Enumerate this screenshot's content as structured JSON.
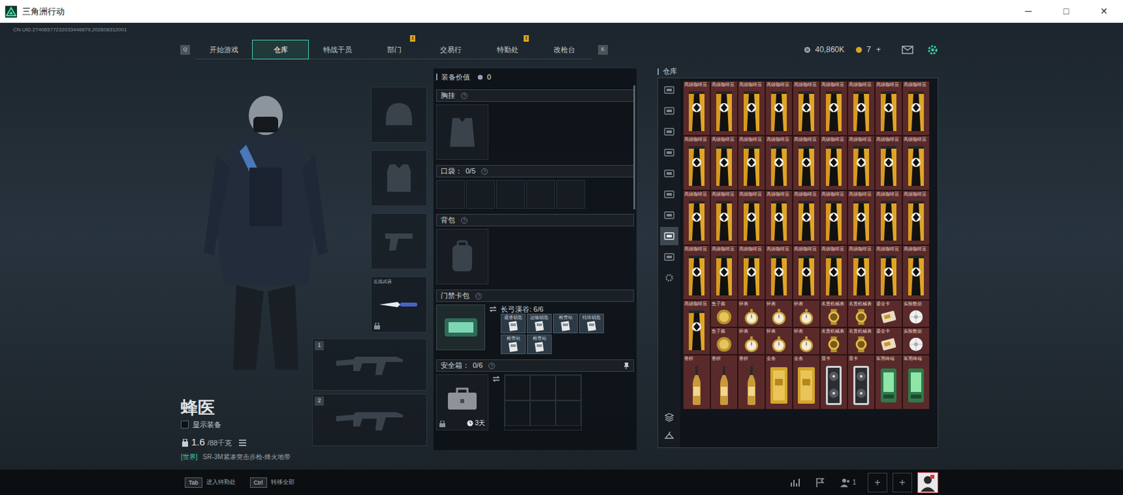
{
  "window": {
    "title": "三角洲行动",
    "controls": [
      "─",
      "□",
      "✕"
    ]
  },
  "uid": "CN.UID.27406577232033446679,202608312001",
  "nav": {
    "prev_key": "Q",
    "next_key": "E",
    "tabs": [
      {
        "label": "开始游戏",
        "selected": false
      },
      {
        "label": "仓库",
        "selected": true
      },
      {
        "label": "特战干员",
        "selected": false
      },
      {
        "label": "部门",
        "selected": false,
        "badge": "!"
      },
      {
        "label": "交易行",
        "selected": false
      },
      {
        "label": "特勤处",
        "selected": false,
        "badge": "!"
      },
      {
        "label": "改枪台",
        "selected": false
      }
    ]
  },
  "currency": {
    "coins": "40,860K",
    "tokens": "7",
    "add": "+"
  },
  "operator": {
    "name": "蜂医",
    "show_equipment": {
      "label": "显示装备",
      "checked": false
    },
    "weight": "1.6",
    "capacity": "/88千克",
    "chat_channel": "[世界]",
    "loadout": "SR-3M紧凑突击步枪-烽火地带"
  },
  "slots": {
    "melee_label": "近战武器",
    "weapon_numbers": [
      "1",
      "2"
    ]
  },
  "loadout": {
    "value_label": "装备价值",
    "value": "0",
    "chest_rig": {
      "title": "胸挂",
      "help": "?"
    },
    "pockets": {
      "title": "口袋：",
      "count": "0/5",
      "help": "?",
      "slots": [
        {
          "filled": false
        },
        {
          "filled": false
        },
        {
          "filled": false
        },
        {
          "filled": false
        },
        {
          "filled": false
        }
      ]
    },
    "backpack": {
      "title": "背包",
      "help": "?"
    },
    "keycard": {
      "title": "门禁卡包",
      "help": "?",
      "map": "长弓溪谷: 6/6",
      "cards": [
        {
          "label": "通道钥匙"
        },
        {
          "label": "运输钥匙"
        },
        {
          "label": "检查站"
        },
        {
          "label": "特殊钥匙"
        },
        {
          "label": "检查站"
        },
        {
          "label": "检查站"
        }
      ]
    },
    "safe_box": {
      "title": "安全箱：",
      "count": "0/6",
      "help": "?",
      "timer": "3天",
      "cells": [
        {
          "filled": false
        },
        {
          "filled": false
        },
        {
          "filled": false
        },
        {
          "filled": false
        },
        {
          "filled": false
        },
        {
          "filled": false
        }
      ]
    }
  },
  "warehouse": {
    "title": "仓库",
    "tabs": [
      {
        "selected": false
      },
      {
        "selected": false
      },
      {
        "selected": false
      },
      {
        "selected": false
      },
      {
        "selected": false
      },
      {
        "selected": false
      },
      {
        "selected": false
      },
      {
        "selected": true
      },
      {
        "selected": false
      },
      {
        "selected": false
      }
    ],
    "items": [
      {
        "label": "高级咖啡豆",
        "kind": "coffee"
      },
      {
        "label": "高级咖啡豆",
        "kind": "coffee"
      },
      {
        "label": "高级咖啡豆",
        "kind": "coffee"
      },
      {
        "label": "高级咖啡豆",
        "kind": "coffee"
      },
      {
        "label": "高级咖啡豆",
        "kind": "coffee"
      },
      {
        "label": "高级咖啡豆",
        "kind": "coffee"
      },
      {
        "label": "高级咖啡豆",
        "kind": "coffee"
      },
      {
        "label": "高级咖啡豆",
        "kind": "coffee"
      },
      {
        "label": "高级咖啡豆",
        "kind": "coffee"
      },
      {
        "label": "高级咖啡豆",
        "kind": "coffee"
      },
      {
        "label": "高级咖啡豆",
        "kind": "coffee"
      },
      {
        "label": "高级咖啡豆",
        "kind": "coffee"
      },
      {
        "label": "高级咖啡豆",
        "kind": "coffee"
      },
      {
        "label": "高级咖啡豆",
        "kind": "coffee"
      },
      {
        "label": "高级咖啡豆",
        "kind": "coffee"
      },
      {
        "label": "高级咖啡豆",
        "kind": "coffee"
      },
      {
        "label": "高级咖啡豆",
        "kind": "coffee"
      },
      {
        "label": "高级咖啡豆",
        "kind": "coffee"
      },
      {
        "label": "高级咖啡豆",
        "kind": "coffee"
      },
      {
        "label": "高级咖啡豆",
        "kind": "coffee"
      },
      {
        "label": "高级咖啡豆",
        "kind": "coffee"
      },
      {
        "label": "高级咖啡豆",
        "kind": "coffee"
      },
      {
        "label": "高级咖啡豆",
        "kind": "coffee"
      },
      {
        "label": "高级咖啡豆",
        "kind": "coffee"
      },
      {
        "label": "高级咖啡豆",
        "kind": "coffee"
      },
      {
        "label": "高级咖啡豆",
        "kind": "coffee"
      },
      {
        "label": "高级咖啡豆",
        "kind": "coffee"
      },
      {
        "label": "高级咖啡豆",
        "kind": "coffee"
      },
      {
        "label": "高级咖啡豆",
        "kind": "coffee"
      },
      {
        "label": "高级咖啡豆",
        "kind": "coffee"
      },
      {
        "label": "高级咖啡豆",
        "kind": "coffee"
      },
      {
        "label": "高级咖啡豆",
        "kind": "coffee"
      },
      {
        "label": "高级咖啡豆",
        "kind": "coffee"
      },
      {
        "label": "高级咖啡豆",
        "kind": "coffee"
      },
      {
        "label": "高级咖啡豆",
        "kind": "coffee"
      },
      {
        "label": "高级咖啡豆",
        "kind": "coffee"
      },
      {
        "label": "高级咖啡豆",
        "kind": "coffee"
      },
      {
        "label": "鱼子酱",
        "kind": "caviar"
      },
      {
        "label": "怀表",
        "kind": "watch"
      },
      {
        "label": "怀表",
        "kind": "watch"
      },
      {
        "label": "怀表",
        "kind": "watch"
      },
      {
        "label": "名贵机械表",
        "kind": "luxury-watch"
      },
      {
        "label": "名贵机械表",
        "kind": "luxury-watch"
      },
      {
        "label": "鎏金卡",
        "kind": "card"
      },
      {
        "label": "实验数据",
        "kind": "disc"
      },
      {
        "label": "鱼子酱",
        "kind": "caviar"
      },
      {
        "label": "怀表",
        "kind": "watch"
      },
      {
        "label": "怀表",
        "kind": "watch"
      },
      {
        "label": "怀表",
        "kind": "watch"
      },
      {
        "label": "名贵机械表",
        "kind": "luxury-watch"
      },
      {
        "label": "名贵机械表",
        "kind": "luxury-watch"
      },
      {
        "label": "鎏金卡",
        "kind": "card"
      },
      {
        "label": "实验数据",
        "kind": "disc"
      },
      {
        "label": "香槟",
        "kind": "champagne"
      },
      {
        "label": "香槟",
        "kind": "champagne"
      },
      {
        "label": "香槟",
        "kind": "champagne"
      },
      {
        "label": "金条",
        "kind": "gold-bar"
      },
      {
        "label": "金条",
        "kind": "gold-bar"
      },
      {
        "label": "显卡",
        "kind": "gpu"
      },
      {
        "label": "显卡",
        "kind": "gpu"
      },
      {
        "label": "军用终端",
        "kind": "terminal"
      },
      {
        "label": "军用终端",
        "kind": "terminal"
      }
    ]
  },
  "bottom_bar": {
    "hints": [
      {
        "key": "Tab",
        "label": "进入特勤处"
      },
      {
        "key": "Ctrl",
        "label": "转移全部"
      }
    ],
    "friends": "1",
    "party_slots": [
      "+",
      "+"
    ]
  }
}
